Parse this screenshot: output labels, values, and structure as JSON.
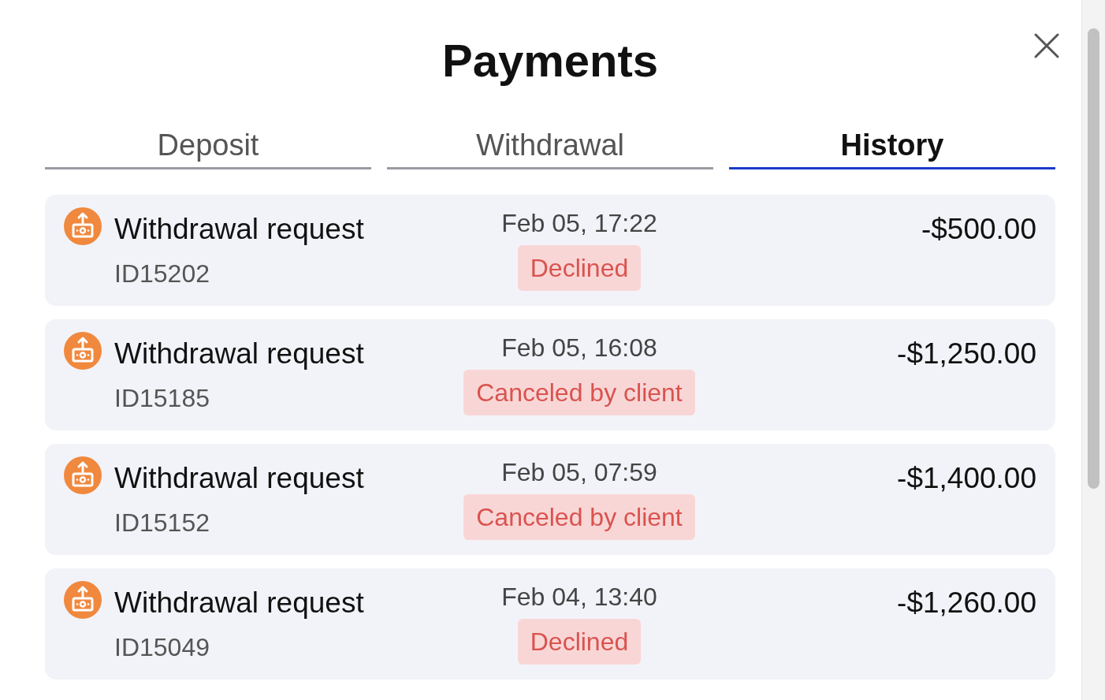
{
  "title": "Payments",
  "tabs": [
    {
      "label": "Deposit",
      "selected": false
    },
    {
      "label": "Withdrawal",
      "selected": false
    },
    {
      "label": "History",
      "selected": true
    }
  ],
  "transactions": [
    {
      "title": "Withdrawal request",
      "id": "ID15202",
      "date": "Feb 05, 17:22",
      "status": "Declined",
      "amount": "-$500.00"
    },
    {
      "title": "Withdrawal request",
      "id": "ID15185",
      "date": "Feb 05, 16:08",
      "status": "Canceled by client",
      "amount": "-$1,250.00"
    },
    {
      "title": "Withdrawal request",
      "id": "ID15152",
      "date": "Feb 05, 07:59",
      "status": "Canceled by client",
      "amount": "-$1,400.00"
    },
    {
      "title": "Withdrawal request",
      "id": "ID15049",
      "date": "Feb 04, 13:40",
      "status": "Declined",
      "amount": "-$1,260.00"
    }
  ]
}
